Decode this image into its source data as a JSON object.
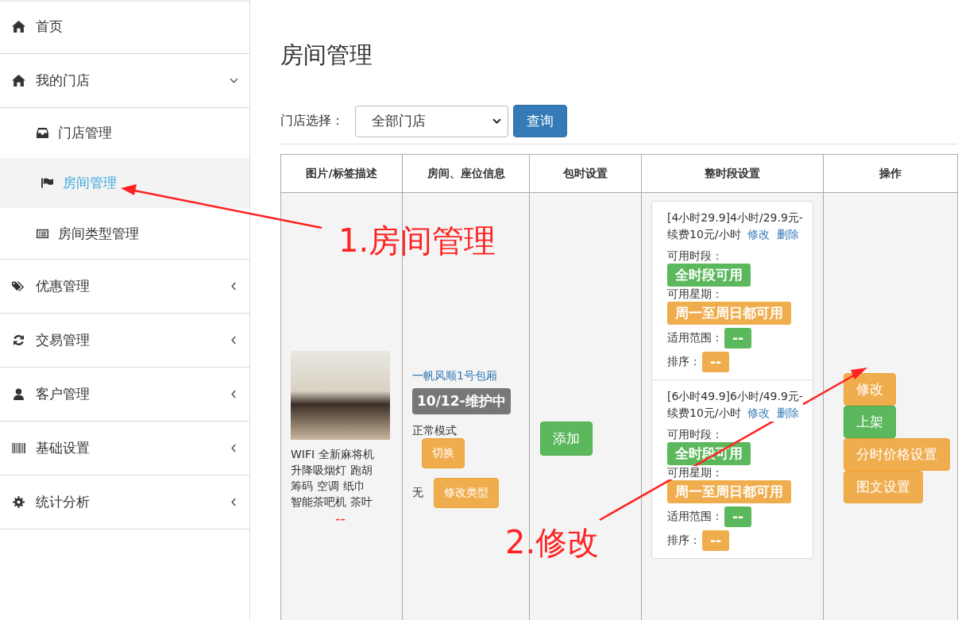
{
  "sidebar": {
    "home": {
      "label": "首页"
    },
    "menus": [
      {
        "label": "我的门店",
        "expanded": true,
        "children": [
          {
            "label": "门店管理",
            "selected": false
          },
          {
            "label": "房间管理",
            "selected": true
          },
          {
            "label": "房间类型管理",
            "selected": false
          }
        ]
      },
      {
        "label": "优惠管理",
        "expanded": false
      },
      {
        "label": "交易管理",
        "expanded": false
      },
      {
        "label": "客户管理",
        "expanded": false
      },
      {
        "label": "基础设置",
        "expanded": false
      },
      {
        "label": "统计分析",
        "expanded": false
      }
    ]
  },
  "page": {
    "title": "房间管理",
    "filter": {
      "label": "门店选择：",
      "store_select": "全部门店",
      "query_button": "查询"
    }
  },
  "table": {
    "columns": [
      "图片/标签描述",
      "房间、座位信息",
      "包时设置",
      "整时段设置",
      "操作"
    ],
    "rows": [
      {
        "tags": [
          "WIFI",
          "全新麻将机",
          "升降吸烟灯",
          "跑胡",
          "筹码",
          "空调",
          "纸巾",
          "智能茶吧机",
          "茶叶"
        ],
        "tag_note": "--",
        "room_name": "一帆风顺1号包厢",
        "room_status": "10/12-维护中",
        "mode": "正常模式",
        "switch_button": "切换",
        "room_type": "无",
        "change_type_button": "修改类型",
        "hourly_button": "添加",
        "time_slots": [
          {
            "text": "[4小时29.9]4小时/29.9元-续费10元/小时",
            "edit_link": "修改",
            "delete_link": "删除",
            "period_label": "可用时段：",
            "period": "全时段可用",
            "week_label": "可用星期：",
            "week": "周一至周日都可用",
            "scope_label": "适用范围：",
            "scope": "--",
            "sort_label": "排序：",
            "sort": "--"
          },
          {
            "text": "[6小时49.9]6小时/49.9元-续费10元/小时",
            "edit_link": "修改",
            "delete_link": "删除",
            "period_label": "可用时段：",
            "period": "全时段可用",
            "week_label": "可用星期：",
            "week": "周一至周日都可用",
            "scope_label": "适用范围：",
            "scope": "--",
            "sort_label": "排序：",
            "sort": "--"
          }
        ],
        "actions": [
          {
            "label": "修改",
            "kind": "warning"
          },
          {
            "label": "上架",
            "kind": "success"
          },
          {
            "label": "分时价格设置",
            "kind": "warning"
          },
          {
            "label": "图文设置",
            "kind": "warning"
          }
        ]
      }
    ]
  },
  "annotations": [
    {
      "text": "1.房间管理"
    },
    {
      "text": "2.修改"
    }
  ]
}
